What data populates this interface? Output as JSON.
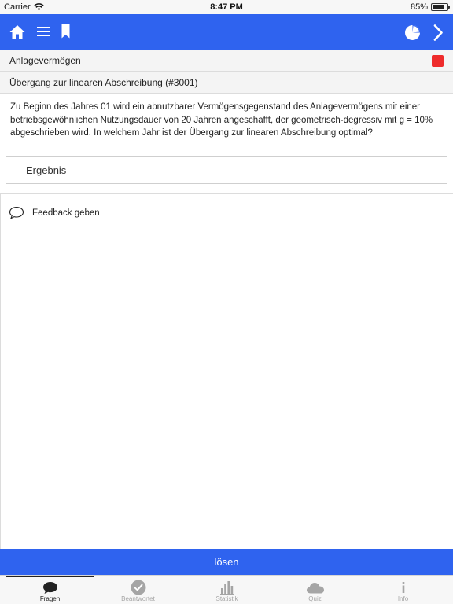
{
  "status_bar": {
    "carrier": "Carrier",
    "time": "8:47 PM",
    "battery": "85%",
    "battery_level": 0.85
  },
  "nav": {
    "icons": [
      "home-icon",
      "menu-icon",
      "bookmark-icon",
      "pie-chart-icon",
      "chevron-right-icon"
    ]
  },
  "category": "Anlagevermögen",
  "question": {
    "title": "Übergang zur linearen Abschreibung (#3001)",
    "text": "Zu Beginn des Jahres 01 wird ein abnutzbarer Vermögensgegenstand des Anlagevermögens mit einer betriebsgewöhnlichen Nutzungsdauer von 20 Jahren angeschafft, der geometrisch-degressiv mit g = 10% abgeschrieben wird. In welchem Jahr ist der Übergang zur linearen Abschreibung optimal?"
  },
  "answer": {
    "placeholder": "Ergebnis",
    "value": ""
  },
  "feedback": {
    "label": "Feedback geben"
  },
  "solve_button": {
    "label": "lösen"
  },
  "tabs": [
    {
      "label": "Fragen",
      "icon": "speech-bubble-icon",
      "active": true
    },
    {
      "label": "Beantwortet",
      "icon": "checkmark-circle-icon",
      "active": false
    },
    {
      "label": "Statistik",
      "icon": "bar-chart-icon",
      "active": false
    },
    {
      "label": "Quiz",
      "icon": "cloud-icon",
      "active": false
    },
    {
      "label": "Info",
      "icon": "info-icon",
      "active": false
    }
  ],
  "colors": {
    "accent": "#2f63ef",
    "stop": "#ee2b2b",
    "tab_inactive": "#a5a5a5"
  }
}
